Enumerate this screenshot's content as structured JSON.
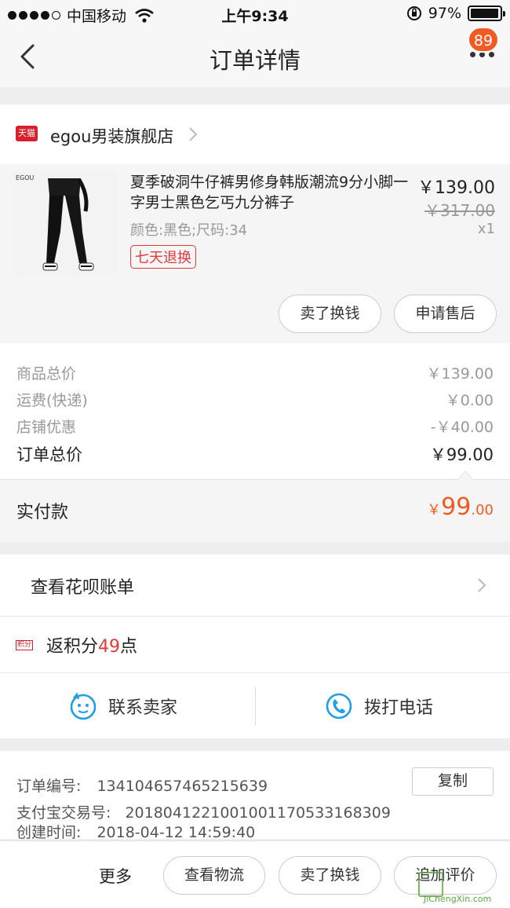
{
  "status_bar": {
    "carrier": "中国移动",
    "time": "上午9:34",
    "battery": "97%",
    "battery_level": 0.97
  },
  "nav": {
    "title": "订单详情",
    "badge_count": "89"
  },
  "shop": {
    "platform_badge": "天猫",
    "name": "egou男装旗舰店"
  },
  "product": {
    "thumbnail_brand": "EGOU",
    "title": "夏季破洞牛仔裤男修身韩版潮流9分小脚一字男士黑色乞丐九分裤子",
    "spec": "颜色:黑色;尺码:34",
    "tag": "七天退换",
    "price": "￥139.00",
    "original_price": "￥317.00",
    "quantity": "x1",
    "buttons": [
      "卖了换钱",
      "申请售后"
    ]
  },
  "summary": {
    "rows": [
      {
        "label": "商品总价",
        "value": "￥139.00"
      },
      {
        "label": "运费(快递)",
        "value": "￥0.00"
      },
      {
        "label": "店铺优惠",
        "value": "-￥40.00"
      }
    ],
    "total_label": "订单总价",
    "total_value": "￥99.00",
    "paid_label": "实付款",
    "paid_currency": "￥",
    "paid_integer": "99",
    "paid_decimal": ".00"
  },
  "huabei": {
    "label": "查看花呗账单"
  },
  "points": {
    "icon_text": "积分",
    "prefix": "返积分",
    "count": "49",
    "suffix": "点"
  },
  "contact": {
    "seller_label": "联系卖家",
    "phone_label": "拨打电话",
    "seller_icon": "chat-face-icon",
    "phone_icon": "phone-icon"
  },
  "order_info": {
    "order_no_label": "订单编号:",
    "order_no": "134104657465215639",
    "copy_label": "复制",
    "alipay_label": "支付宝交易号:",
    "alipay_no": "2018041221001001170533168309",
    "created_label": "创建时间:",
    "created_time": "2018-04-12 14:59:40"
  },
  "bottom_bar": {
    "more_label": "更多",
    "buttons": [
      "查看物流",
      "卖了换钱",
      "追加评价"
    ]
  },
  "watermark": {
    "text": "JiChengXin.com"
  },
  "colors": {
    "accent_orange": "#f15a22",
    "tmall_red": "#d91f2b",
    "tag_red": "#e4393c",
    "icon_blue": "#1e9fe8"
  }
}
